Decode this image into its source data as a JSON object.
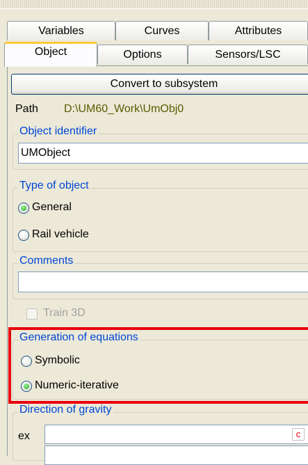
{
  "tabs_row1": [
    {
      "label": "Variables"
    },
    {
      "label": "Curves"
    },
    {
      "label": "Attributes"
    }
  ],
  "tabs_row2": [
    {
      "label": "Object",
      "selected": true
    },
    {
      "label": "Options"
    },
    {
      "label": "Sensors/LSC"
    }
  ],
  "convert_button": "Convert to subsystem",
  "path": {
    "label": "Path",
    "value": "D:\\UM60_Work\\UmObj0"
  },
  "object_identifier": {
    "title": "Object identifier",
    "value": "UMObject"
  },
  "type_of_object": {
    "title": "Type of object",
    "options": [
      {
        "label": "General",
        "selected": true
      },
      {
        "label": "Rail vehicle",
        "selected": false
      }
    ]
  },
  "comments": {
    "title": "Comments",
    "value": ""
  },
  "train3d": {
    "label": "Train 3D",
    "checked": false,
    "enabled": false
  },
  "generation_of_equations": {
    "title": "Generation of equations",
    "options": [
      {
        "label": "Symbolic",
        "selected": false
      },
      {
        "label": "Numeric-iterative",
        "selected": true
      }
    ]
  },
  "direction_of_gravity": {
    "title": "Direction of gravity",
    "ex_label": "ex",
    "ex_value": "",
    "c_button": "c"
  },
  "colors": {
    "highlight": "#E8000D",
    "group_title": "#0046D5",
    "tab_accent": "#FFC83C"
  }
}
